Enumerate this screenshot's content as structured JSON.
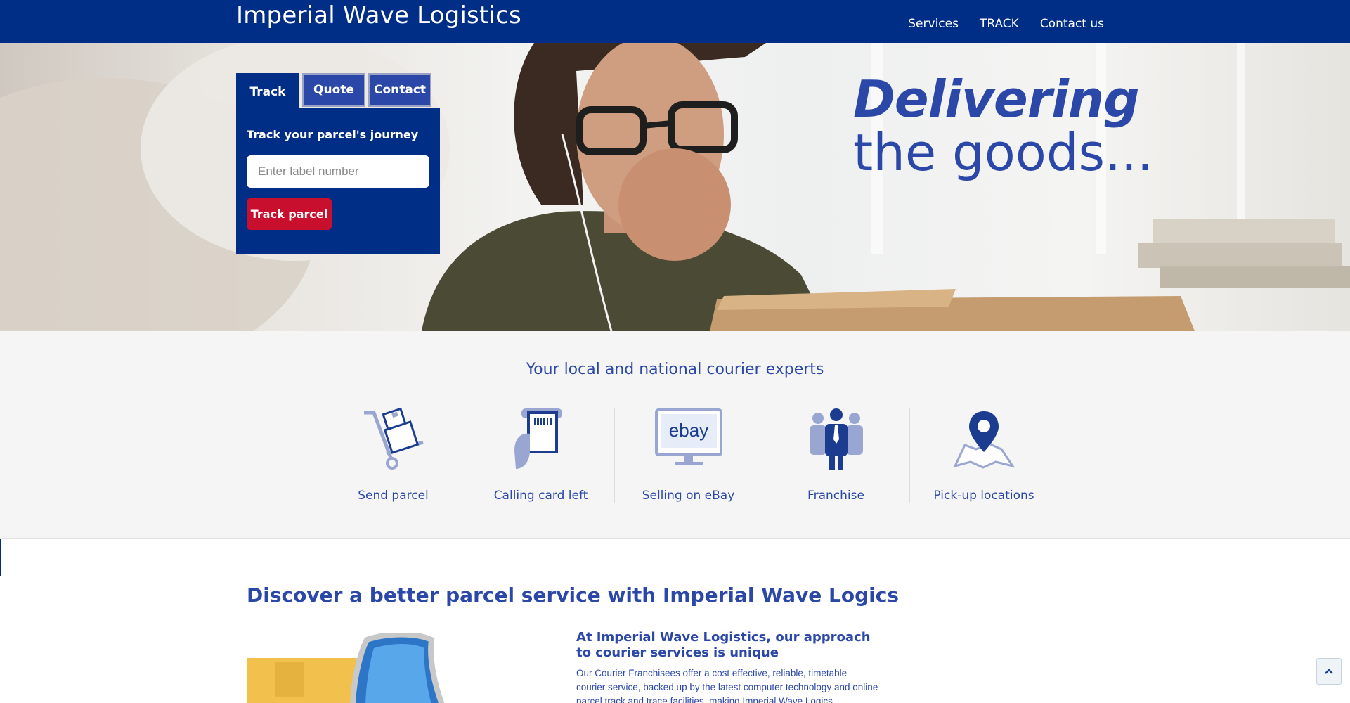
{
  "header": {
    "brand": "Imperial Wave Logistics",
    "nav": [
      {
        "label": "Services"
      },
      {
        "label": "TRACK"
      },
      {
        "label": "Contact us"
      }
    ]
  },
  "hero": {
    "tagline_bold": "Delivering",
    "tagline_rest": "the goods..."
  },
  "widget": {
    "tabs": [
      {
        "label": "Track",
        "active": true
      },
      {
        "label": "Quote",
        "active": false
      },
      {
        "label": "Contact",
        "active": false
      }
    ],
    "title": "Track your parcel's journey",
    "input_placeholder": "Enter label number",
    "button_label": "Track parcel"
  },
  "experts": {
    "title": "Your local and national courier experts",
    "features": [
      {
        "label": "Send parcel",
        "icon": "hand-truck-parcel-icon"
      },
      {
        "label": "Calling card left",
        "icon": "calling-card-icon"
      },
      {
        "label": "Selling on eBay",
        "icon": "ebay-monitor-icon"
      },
      {
        "label": "Franchise",
        "icon": "franchise-people-icon"
      },
      {
        "label": "Pick-up locations",
        "icon": "map-pin-icon"
      }
    ]
  },
  "discover": {
    "title": "Discover a better parcel service with Imperial Wave Logics",
    "approach_title": "At Imperial Wave Logistics, our approach to courier services is unique",
    "approach_body": "Our Courier Franchisees offer a cost effective, reliable, timetable courier service, backed up by the latest computer technology and online parcel track and trace facilities, making Imperial Wave Logics"
  },
  "colors": {
    "brand_navy": "#002d86",
    "brand_blue": "#2b47a8",
    "cta_red": "#c8102e",
    "section_gray": "#f5f5f5"
  },
  "back_to_top_icon": "chevron-up-icon"
}
